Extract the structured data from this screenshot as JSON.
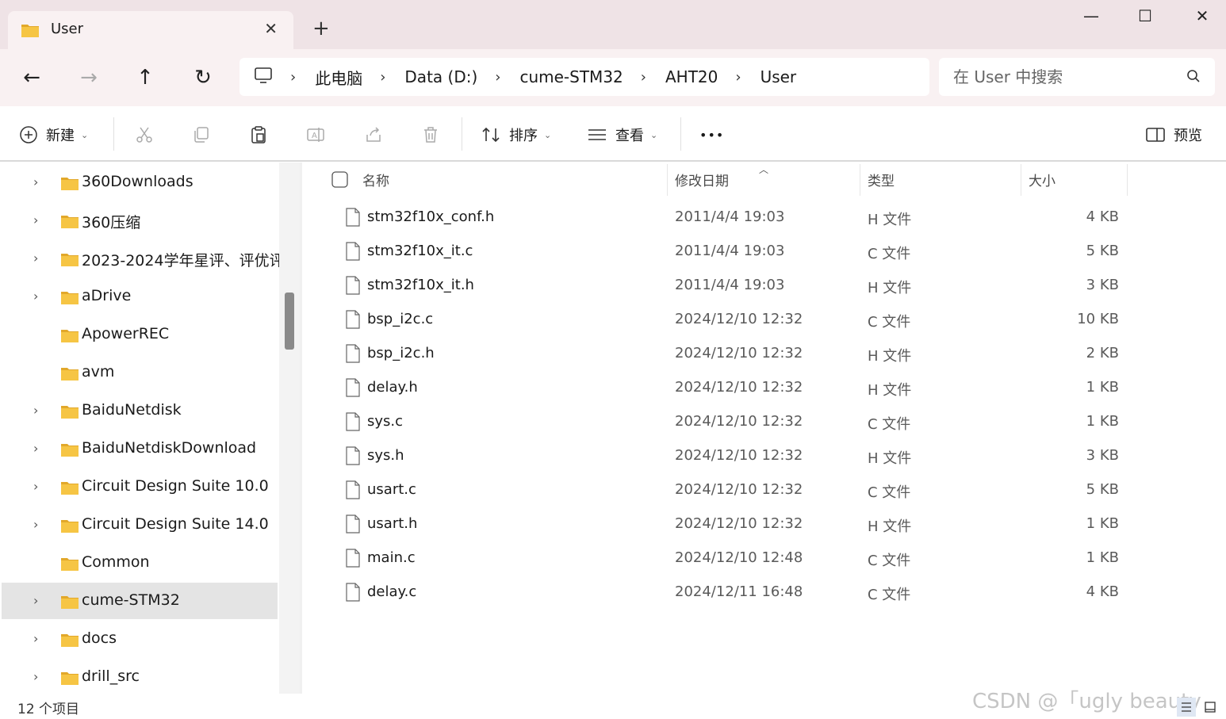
{
  "tab": {
    "title": "User",
    "close": "✕",
    "new_tab": "+"
  },
  "window": {
    "minimize": "—",
    "maximize": "☐",
    "close": "✕"
  },
  "nav": {
    "back": "←",
    "forward": "→",
    "up": "↑",
    "refresh": "↻"
  },
  "breadcrumb": [
    "此电脑",
    "Data (D:)",
    "cume-STM32",
    "AHT20",
    "User"
  ],
  "search": {
    "placeholder": "在 User 中搜索"
  },
  "toolbar": {
    "new_label": "新建",
    "sort_label": "排序",
    "view_label": "查看",
    "more": "•••",
    "preview_label": "预览"
  },
  "sidebar": {
    "items": [
      {
        "label": "360Downloads",
        "chevron": true,
        "selected": false
      },
      {
        "label": "360压缩",
        "chevron": true,
        "selected": false
      },
      {
        "label": "2023-2024学年星评、评优评先",
        "chevron": true,
        "selected": false
      },
      {
        "label": "aDrive",
        "chevron": true,
        "selected": false
      },
      {
        "label": "ApowerREC",
        "chevron": false,
        "selected": false
      },
      {
        "label": "avm",
        "chevron": false,
        "selected": false
      },
      {
        "label": "BaiduNetdisk",
        "chevron": true,
        "selected": false
      },
      {
        "label": "BaiduNetdiskDownload",
        "chevron": true,
        "selected": false
      },
      {
        "label": "Circuit Design Suite 10.0",
        "chevron": true,
        "selected": false
      },
      {
        "label": "Circuit Design Suite 14.0",
        "chevron": true,
        "selected": false
      },
      {
        "label": "Common",
        "chevron": false,
        "selected": false
      },
      {
        "label": "cume-STM32",
        "chevron": true,
        "selected": true
      },
      {
        "label": "docs",
        "chevron": true,
        "selected": false
      },
      {
        "label": "drill_src",
        "chevron": true,
        "selected": false
      }
    ]
  },
  "columns": {
    "name": "名称",
    "date": "修改日期",
    "type": "类型",
    "size": "大小"
  },
  "files": [
    {
      "name": "stm32f10x_conf.h",
      "date": "2011/4/4 19:03",
      "type": "H 文件",
      "size": "4 KB"
    },
    {
      "name": "stm32f10x_it.c",
      "date": "2011/4/4 19:03",
      "type": "C 文件",
      "size": "5 KB"
    },
    {
      "name": "stm32f10x_it.h",
      "date": "2011/4/4 19:03",
      "type": "H 文件",
      "size": "3 KB"
    },
    {
      "name": "bsp_i2c.c",
      "date": "2024/12/10 12:32",
      "type": "C 文件",
      "size": "10 KB"
    },
    {
      "name": "bsp_i2c.h",
      "date": "2024/12/10 12:32",
      "type": "H 文件",
      "size": "2 KB"
    },
    {
      "name": "delay.h",
      "date": "2024/12/10 12:32",
      "type": "H 文件",
      "size": "1 KB"
    },
    {
      "name": "sys.c",
      "date": "2024/12/10 12:32",
      "type": "C 文件",
      "size": "1 KB"
    },
    {
      "name": "sys.h",
      "date": "2024/12/10 12:32",
      "type": "H 文件",
      "size": "3 KB"
    },
    {
      "name": "usart.c",
      "date": "2024/12/10 12:32",
      "type": "C 文件",
      "size": "5 KB"
    },
    {
      "name": "usart.h",
      "date": "2024/12/10 12:32",
      "type": "H 文件",
      "size": "1 KB"
    },
    {
      "name": "main.c",
      "date": "2024/12/10 12:48",
      "type": "C 文件",
      "size": "1 KB"
    },
    {
      "name": "delay.c",
      "date": "2024/12/11 16:48",
      "type": "C 文件",
      "size": "4 KB"
    }
  ],
  "status": {
    "item_count": "12 个项目"
  },
  "watermark": "CSDN @「ugly beauty",
  "colors": {
    "folder": "#f6c544",
    "folder_dark": "#e2a82a",
    "selected_row": "#e4e4e4",
    "chrome": "#efe3e6"
  }
}
